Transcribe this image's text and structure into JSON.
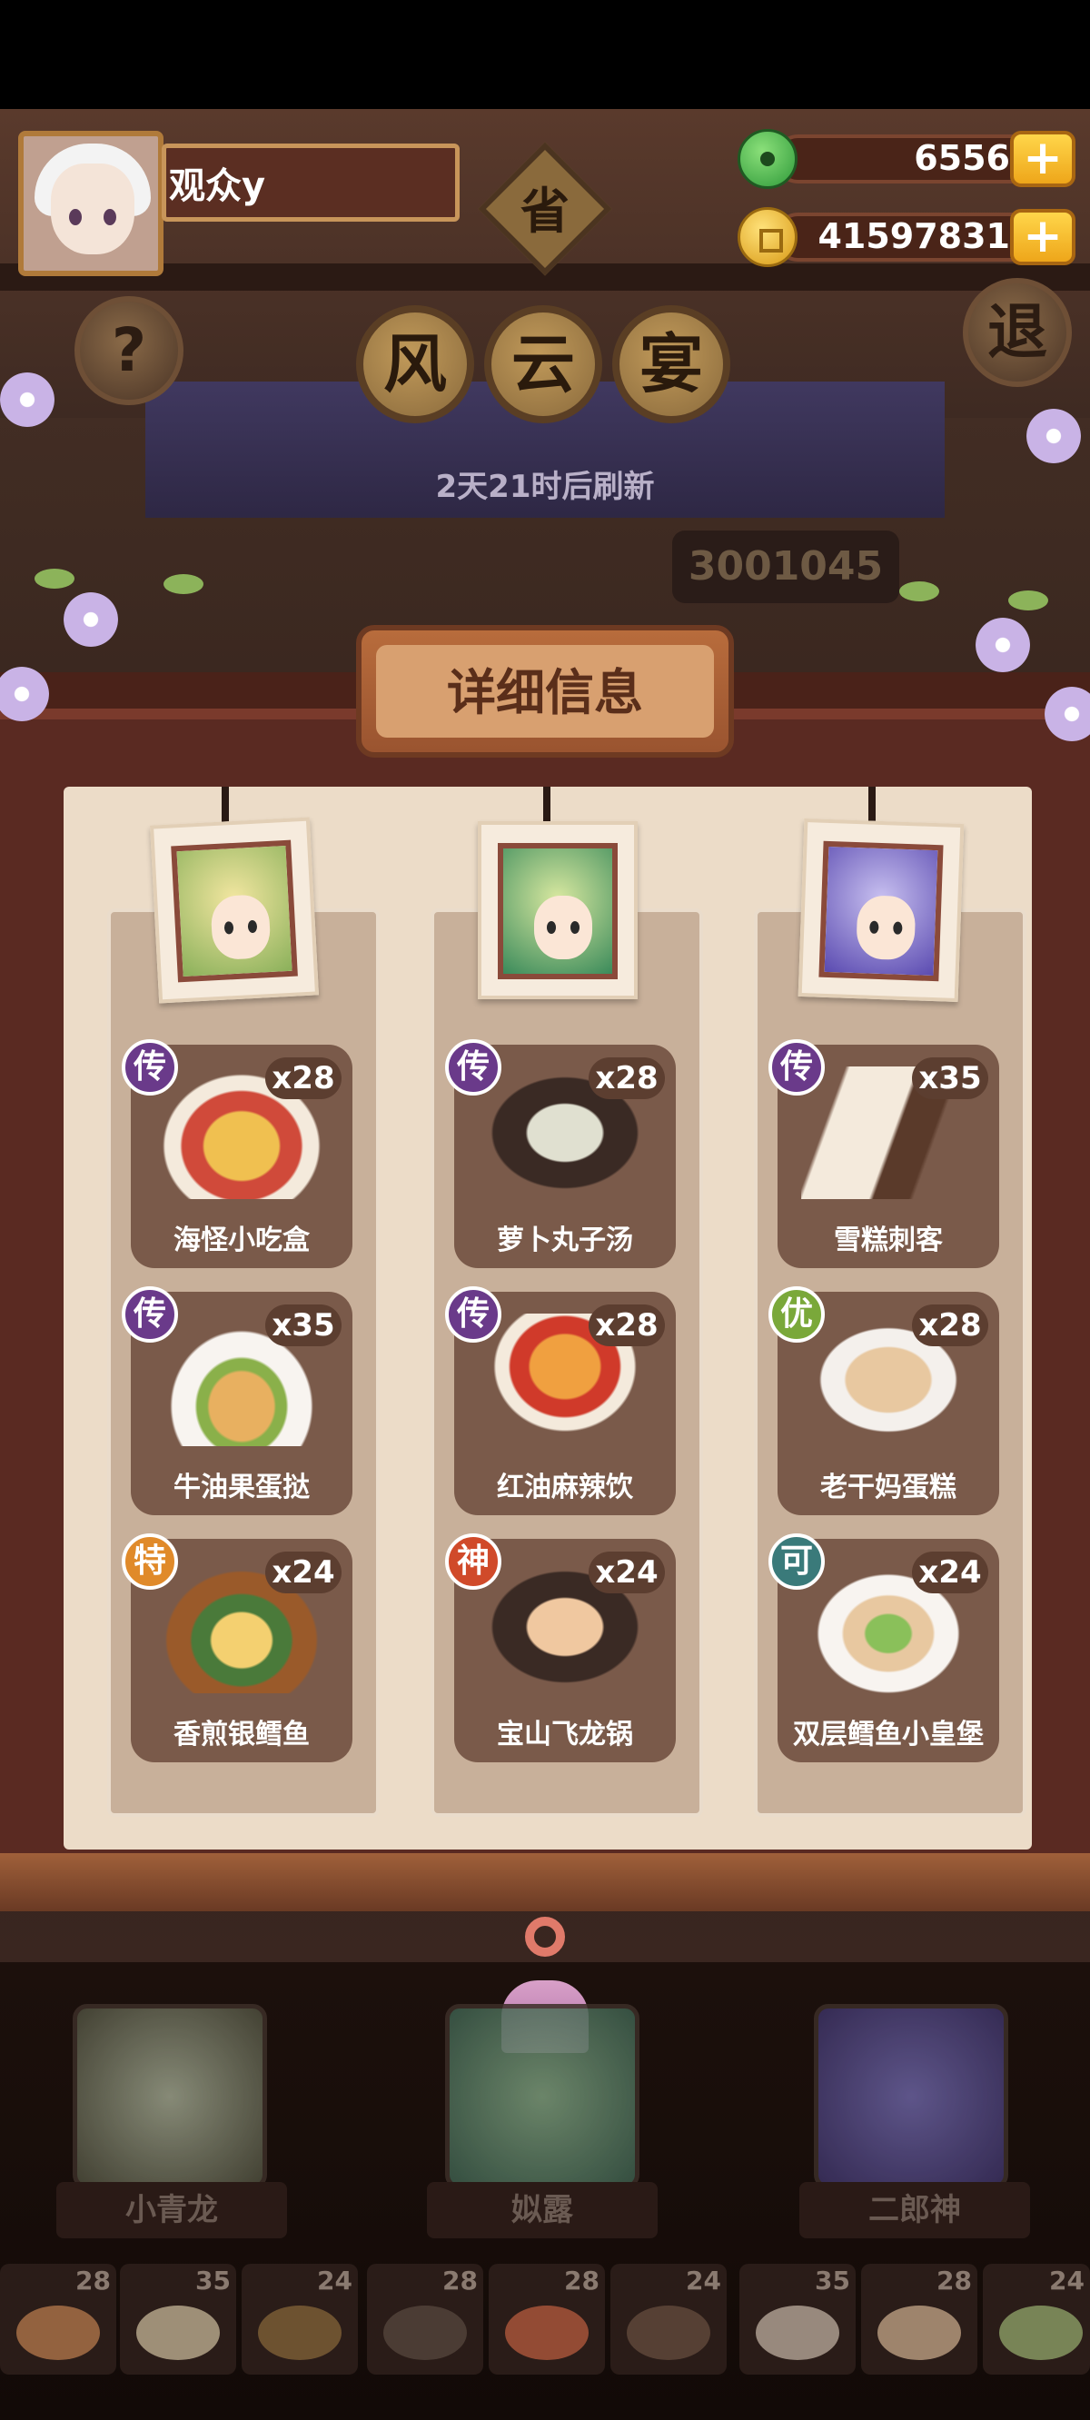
{
  "header": {
    "player_name": "观众y",
    "jade_amount": "6556",
    "coin_amount": "41597831",
    "province_char": "省",
    "title_chars": [
      "风",
      "云",
      "宴"
    ],
    "help_label": "?",
    "exit_label": "退",
    "refresh_text": "2天21时后刷新",
    "score": "3001045"
  },
  "panel": {
    "title": "详细信息",
    "columns": [
      {
        "character": "小青龙",
        "dishes": [
          {
            "rarity": "传",
            "name": "海怪小吃盒",
            "count": "x28"
          },
          {
            "rarity": "传",
            "name": "牛油果蛋挞",
            "count": "x35"
          },
          {
            "rarity": "特",
            "name": "香煎银鳕鱼",
            "count": "x24"
          }
        ]
      },
      {
        "character": "姒露",
        "dishes": [
          {
            "rarity": "传",
            "name": "萝卜丸子汤",
            "count": "x28"
          },
          {
            "rarity": "传",
            "name": "红油麻辣饮",
            "count": "x28"
          },
          {
            "rarity": "神",
            "name": "宝山飞龙锅",
            "count": "x24"
          }
        ]
      },
      {
        "character": "二郎神",
        "dishes": [
          {
            "rarity": "传",
            "name": "雪糕刺客",
            "count": "x35"
          },
          {
            "rarity": "优",
            "name": "老干妈蛋糕",
            "count": "x28"
          },
          {
            "rarity": "可",
            "name": "双层鳕鱼小皇堡",
            "count": "x24"
          }
        ]
      }
    ]
  },
  "characters": [
    "小青龙",
    "姒露",
    "二郎神"
  ],
  "dish_strip": [
    "28",
    "35",
    "24",
    "28",
    "28",
    "24",
    "35",
    "28",
    "24"
  ],
  "colors": {
    "rarity_legendary": "#6a3a8a",
    "rarity_special": "#e08a2a",
    "rarity_divine": "#d04a2a",
    "rarity_good": "#7aa83a",
    "rarity_ok": "#3a7a7a",
    "panel_bg": "#ecdcc8",
    "frame": "#5a2a22"
  },
  "icons": [
    "jade-icon",
    "coin-icon",
    "plus-icon",
    "question-icon",
    "flower-icon"
  ]
}
